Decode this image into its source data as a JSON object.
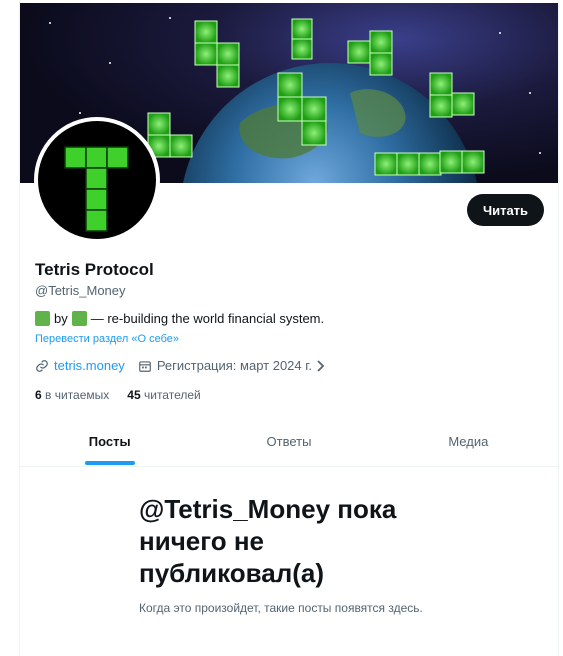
{
  "profile": {
    "name": "Tetris Protocol",
    "handle": "@Tetris_Money",
    "follow_label": "Читать",
    "bio_by": "by",
    "bio_text": "— re-building the world financial system.",
    "translate_label": "Перевести раздел «О себе»",
    "website": "tetris.money",
    "joined": "Регистрация: март 2024 г.",
    "following_count": "6",
    "following_label": "в читаемых",
    "followers_count": "45",
    "followers_label": "читателей"
  },
  "tabs": [
    {
      "label": "Посты",
      "active": true
    },
    {
      "label": "Ответы",
      "active": false
    },
    {
      "label": "Медиа",
      "active": false
    }
  ],
  "empty_state": {
    "title": "@Tetris_Money пока ничего не публиковал(а)",
    "subtitle": "Когда это произойдет, такие посты появятся здесь."
  },
  "colors": {
    "accent": "#1d9bf0",
    "button_bg": "#0f1419",
    "logo_green": "#3fd02c",
    "bio_square": "#5fb34a"
  },
  "icons": {
    "link": "link-icon",
    "calendar": "calendar-icon",
    "chevron": "chevron-right-icon"
  }
}
